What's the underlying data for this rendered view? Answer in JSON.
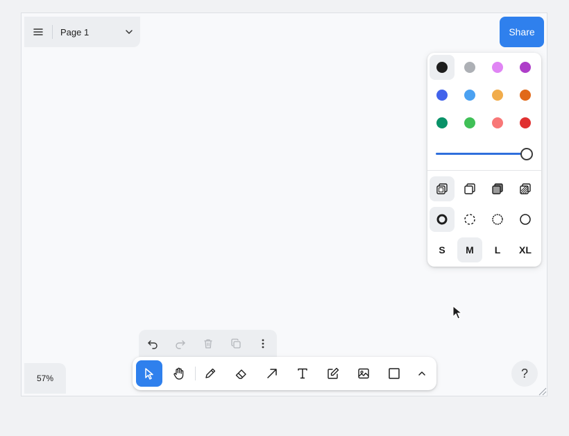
{
  "page": {
    "name": "Page 1"
  },
  "header": {
    "share_label": "Share"
  },
  "style_panel": {
    "colors": [
      {
        "name": "black",
        "hex": "#1d1d1d"
      },
      {
        "name": "grey",
        "hex": "#adb0b5"
      },
      {
        "name": "light-violet",
        "hex": "#e085f4"
      },
      {
        "name": "violet",
        "hex": "#ae3ec9"
      },
      {
        "name": "blue",
        "hex": "#4263eb"
      },
      {
        "name": "light-blue",
        "hex": "#4ba1f1"
      },
      {
        "name": "yellow",
        "hex": "#f1ac4b"
      },
      {
        "name": "orange",
        "hex": "#e16919"
      },
      {
        "name": "green",
        "hex": "#099268"
      },
      {
        "name": "light-green",
        "hex": "#40c057"
      },
      {
        "name": "light-red",
        "hex": "#f87777"
      },
      {
        "name": "red",
        "hex": "#e03131"
      }
    ],
    "selected_color": "black",
    "opacity": 1.0,
    "fill_icons": [
      "fill-none-icon",
      "fill-semi-icon",
      "fill-solid-icon",
      "fill-pattern-icon"
    ],
    "dash_icons": [
      "dash-draw-icon",
      "dash-dashed-icon",
      "dash-dotted-icon",
      "dash-solid-icon"
    ],
    "sizes": [
      "S",
      "M",
      "L",
      "XL"
    ],
    "selected_size": "M"
  },
  "actions": [
    "undo-icon",
    "redo-icon",
    "trash-icon",
    "duplicate-icon",
    "more-vertical-icon"
  ],
  "tools": [
    "select-icon",
    "hand-icon",
    "draw-icon",
    "eraser-icon",
    "arrow-icon",
    "text-icon",
    "note-icon",
    "image-icon",
    "rectangle-icon",
    "chevron-up-icon"
  ],
  "footer": {
    "zoom": "57%",
    "help": "?"
  },
  "accent": "#2f80ed"
}
